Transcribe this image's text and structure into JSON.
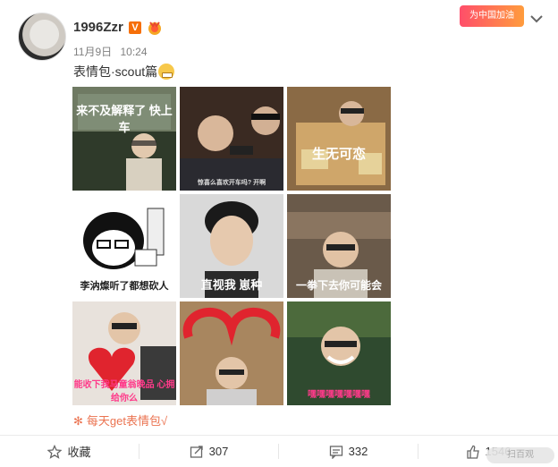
{
  "post": {
    "username": "1996Zzr",
    "vip_label": "V",
    "date": "11月9日",
    "time": "10:24",
    "text": "表情包·scout篇",
    "badge": "为中国加油",
    "tag_icon": "flower-icon",
    "tag_text": "每天get表情包√"
  },
  "images": [
    {
      "caption": "来不及解释了 快上车",
      "caption_color": "#ffffff",
      "bg": "#6f7a63"
    },
    {
      "caption": "惊喜么喜欢开车吗? 开啊",
      "caption_color": "#dddddd",
      "bg": "#3a2a22"
    },
    {
      "caption": "生无可恋",
      "caption_color": "#ffffff",
      "bg": "#8a6a45"
    },
    {
      "caption": "李汭燦听了都想砍人",
      "caption_color": "#222222",
      "bg": "#ffffff"
    },
    {
      "caption": "直视我 崽种",
      "caption_color": "#ffffff",
      "bg": "#d9d9d9"
    },
    {
      "caption": "一拳下去你可能会",
      "caption_color": "#ffffff",
      "bg": "#6a5a4a"
    },
    {
      "caption": "能收下我马童翁晚品 心拥给你么",
      "caption_color": "#ff3a8a",
      "bg": "#e8e2dc"
    },
    {
      "caption": "",
      "caption_color": "#ffffff",
      "bg": "#a8865f"
    },
    {
      "caption": "嘿嘿嘿嘿嘿嘿嘿",
      "caption_color": "#ff3a8a",
      "bg": "#2f4a2f"
    }
  ],
  "actions": {
    "favorite": "收藏",
    "repost": "307",
    "comment": "332",
    "like": "1546"
  },
  "watermark": "扫百观"
}
